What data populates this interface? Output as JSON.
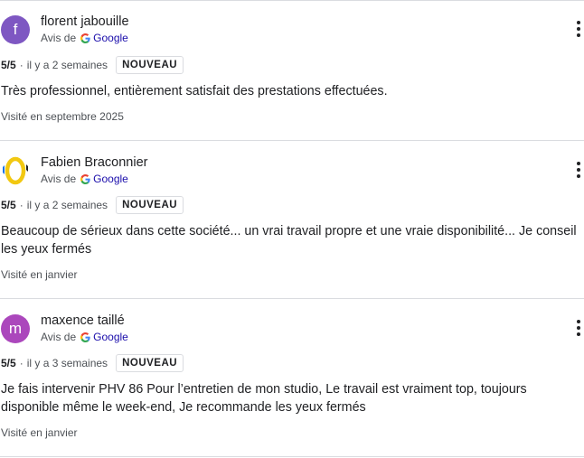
{
  "source_prefix": "Avis de",
  "source_name": "Google",
  "icons": {
    "google": "google-g-icon",
    "more": "more-vert-icon"
  },
  "reviews": [
    {
      "name": "florent jabouille",
      "avatar_letter": "f",
      "avatar_color": "#7e57c2",
      "rating": "5/5",
      "separator": "·",
      "date": "il y a 2 semaines",
      "badge": "NOUVEAU",
      "text": "Très professionnel, entièrement satisfait des prestations effectuées.",
      "visited": "Visité en septembre 2025"
    },
    {
      "name": "Fabien Braconnier",
      "avatar_letter": "",
      "avatar_color": "#f2c811",
      "rating": "5/5",
      "separator": "·",
      "date": "il y a 2 semaines",
      "badge": "NOUVEAU",
      "text": "Beaucoup de sérieux dans cette société... un vrai travail propre et une vraie disponibilité... Je conseil les yeux fermés",
      "visited": "Visité en janvier"
    },
    {
      "name": "maxence taillé",
      "avatar_letter": "m",
      "avatar_color": "#ab47bc",
      "rating": "5/5",
      "separator": "·",
      "date": "il y a 3 semaines",
      "badge": "NOUVEAU",
      "text": "Je fais intervenir PHV 86 Pour l’entretien de mon studio, Le travail est vraiment top, toujours disponible même le week-end, Je recommande les yeux fermés",
      "visited": "Visité en janvier"
    }
  ]
}
